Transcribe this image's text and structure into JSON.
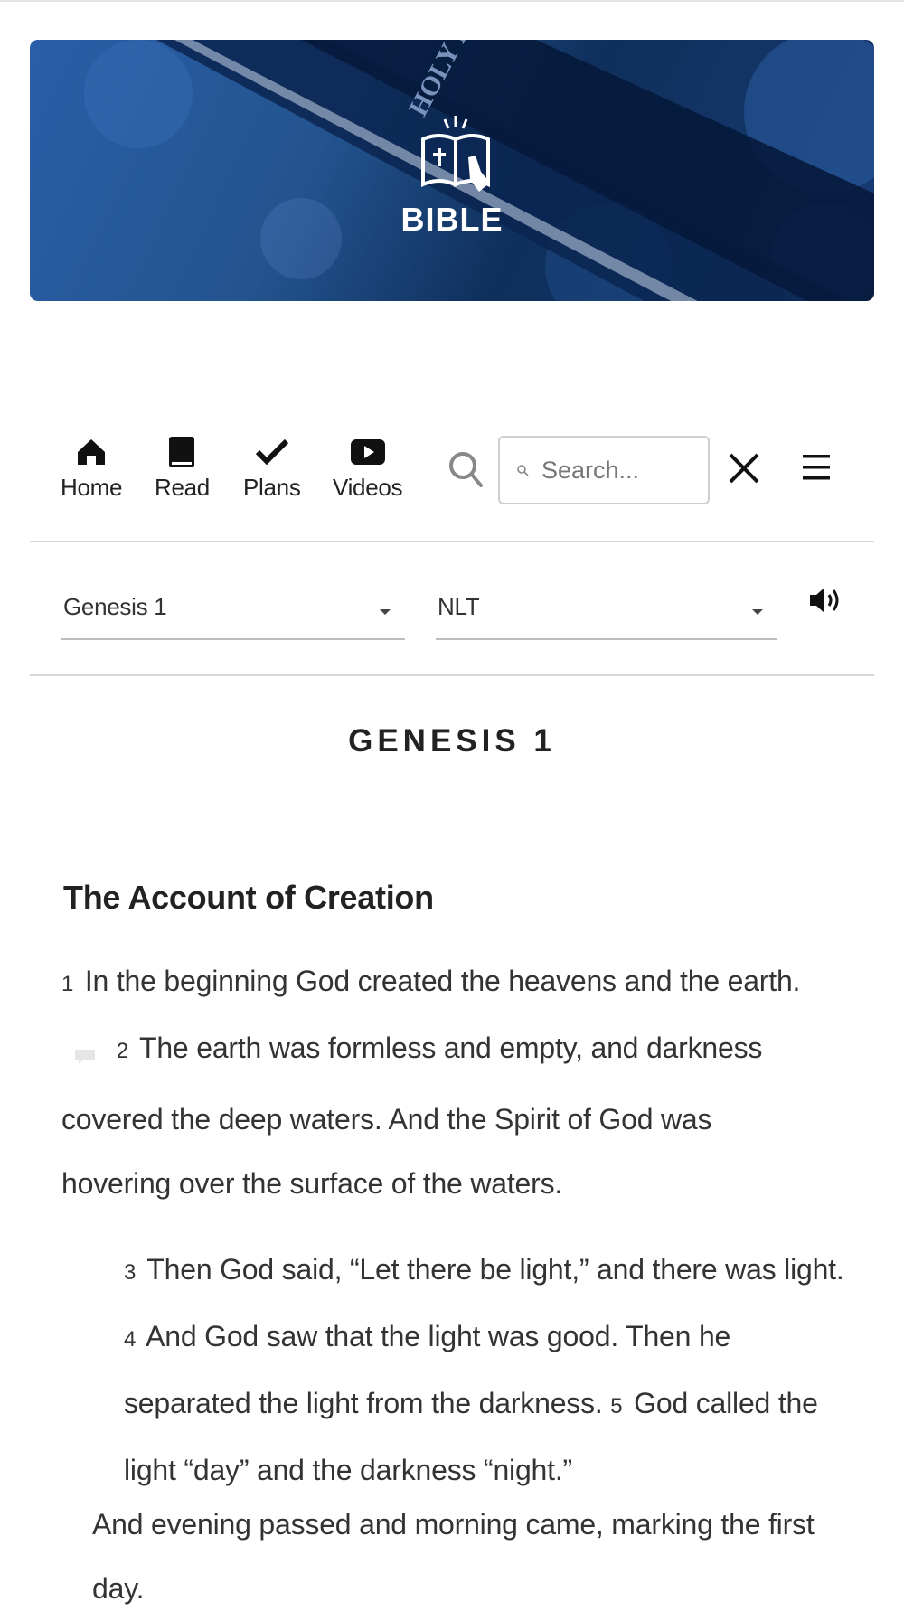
{
  "banner": {
    "logo_text": "BIBLE",
    "book_text": "HOLY BIBLE"
  },
  "nav": {
    "items": [
      {
        "label": "Home",
        "icon": "home-icon"
      },
      {
        "label": "Read",
        "icon": "book-icon"
      },
      {
        "label": "Plans",
        "icon": "check-icon"
      },
      {
        "label": "Videos",
        "icon": "play-icon"
      }
    ],
    "search_placeholder": "Search..."
  },
  "selectors": {
    "passage": "Genesis 1",
    "version": "NLT"
  },
  "reading": {
    "chapter_title": "GENESIS 1",
    "section_heading": "The Account of Creation",
    "verses": [
      {
        "num": "1",
        "text": "In the beginning God created the heavens and the earth."
      },
      {
        "num": "2",
        "text": "The earth was formless and empty, and darkness covered the deep waters. And the Spirit of God was hovering over the surface of the waters."
      },
      {
        "num": "3",
        "text": "Then God said, “Let there be light,” and there was light."
      },
      {
        "num": "4",
        "text": "And God saw that the light was good. Then he separated the light from the darkness."
      },
      {
        "num": "5",
        "text": "God called the light “day” and the darkness “night.”"
      }
    ],
    "closing_text": "And evening passed and morning came, marking the first day."
  }
}
